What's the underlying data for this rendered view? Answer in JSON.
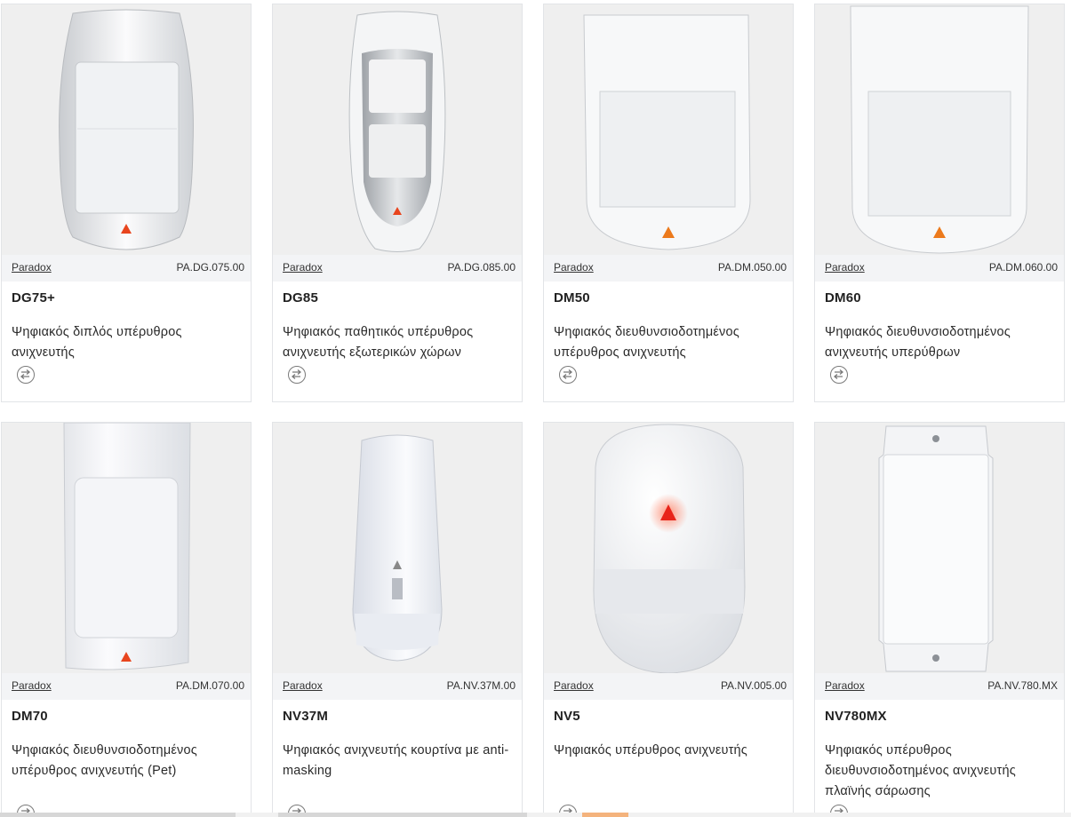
{
  "products": [
    {
      "brand": "Paradox",
      "sku": "PA.DG.075.00",
      "name": "DG75+",
      "description": "Ψηφιακός διπλός υπέρυθρος ανιχνευτής",
      "compare_icon": "compare-arrows-icon"
    },
    {
      "brand": "Paradox",
      "sku": "PA.DG.085.00",
      "name": "DG85",
      "description": "Ψηφιακός παθητικός υπέρυθρος ανιχνευτής εξωτερικών χώρων",
      "compare_icon": "compare-arrows-icon"
    },
    {
      "brand": "Paradox",
      "sku": "PA.DM.050.00",
      "name": "DM50",
      "description": "Ψηφιακός διευθυνσιοδοτημένος υπέρυθρος ανιχνευτής",
      "compare_icon": "compare-arrows-icon"
    },
    {
      "brand": "Paradox",
      "sku": "PA.DM.060.00",
      "name": "DM60",
      "description": "Ψηφιακός διευθυνσιοδοτημένος ανιχνευτής υπερύθρων",
      "compare_icon": "compare-arrows-icon"
    },
    {
      "brand": "Paradox",
      "sku": "PA.DM.070.00",
      "name": "DM70",
      "description": "Ψηφιακός διευθυνσιοδοτημένος υπέρυθρος ανιχνευτής (Pet)",
      "compare_icon": "compare-arrows-icon"
    },
    {
      "brand": "Paradox",
      "sku": "PA.NV.37M.00",
      "name": "NV37M",
      "description": "Ψηφιακός ανιχνευτής κουρτίνα με anti-masking",
      "compare_icon": "compare-arrows-icon"
    },
    {
      "brand": "Paradox",
      "sku": "PA.NV.005.00",
      "name": "NV5",
      "description": "Ψηφιακός υπέρυθρος ανιχνευτής",
      "compare_icon": "compare-arrows-icon"
    },
    {
      "brand": "Paradox",
      "sku": "PA.NV.780.MX",
      "name": "NV780MX",
      "description": "Ψηφιακός υπέρυθρος διευθυνσιοδοτημένος ανιχνευτής πλαϊνής σάρωσης",
      "compare_icon": "compare-arrows-icon"
    }
  ],
  "colors": {
    "indicator": "#e8451e",
    "meta_bg": "#f3f4f6",
    "image_bg": "#efefef",
    "border": "#e2e4e7"
  }
}
